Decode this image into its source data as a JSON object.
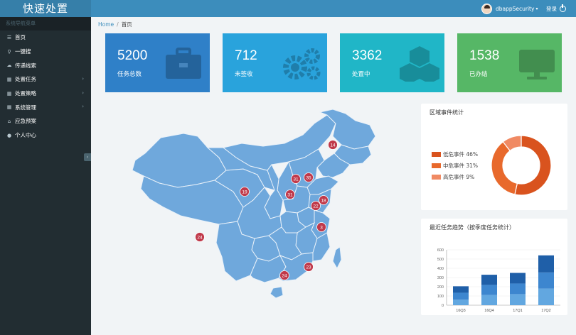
{
  "header": {
    "title": "快速处置",
    "username": "dbappSecurity",
    "login_label": "登录"
  },
  "sidebar": {
    "header": "系统导航菜单",
    "items": [
      {
        "label": "首页",
        "icon": "menu-icon"
      },
      {
        "label": "一键搜",
        "icon": "search-icon"
      },
      {
        "label": "传递线索",
        "icon": "cloud-icon"
      },
      {
        "label": "处置任务",
        "icon": "grid-icon",
        "has_children": true
      },
      {
        "label": "处置策略",
        "icon": "grid-icon",
        "has_children": true
      },
      {
        "label": "系统管理",
        "icon": "grid-icon",
        "has_children": true
      },
      {
        "label": "应急预案",
        "icon": "bank-icon"
      },
      {
        "label": "个人中心",
        "icon": "user-icon"
      }
    ]
  },
  "breadcrumb": {
    "home": "Home",
    "current": "首页"
  },
  "stats": [
    {
      "value": "5200",
      "label": "任务总数",
      "color": "#2f80c8",
      "icon": "briefcase-icon"
    },
    {
      "value": "712",
      "label": "未签收",
      "color": "#29a3dc",
      "icon": "gears-icon"
    },
    {
      "value": "3362",
      "label": "处置中",
      "color": "#20b6c7",
      "icon": "cubes-icon"
    },
    {
      "value": "1538",
      "label": "已办结",
      "color": "#56b766",
      "icon": "monitor-icon"
    }
  ],
  "map": {
    "markers": [
      {
        "label": "14"
      },
      {
        "label": "31"
      },
      {
        "label": "35"
      },
      {
        "label": "19"
      },
      {
        "label": "31"
      },
      {
        "label": "18"
      },
      {
        "label": "22"
      },
      {
        "label": "3"
      },
      {
        "label": "24"
      },
      {
        "label": "24"
      },
      {
        "label": "23"
      }
    ]
  },
  "region_panel": {
    "title": "区域事件统计",
    "legend": [
      {
        "label": "低危事件",
        "pct": "46%",
        "color": "#d9531e"
      },
      {
        "label": "中危事件",
        "pct": "31%",
        "color": "#e8692c"
      },
      {
        "label": "高危事件",
        "pct": "9%",
        "color": "#f08a63"
      }
    ],
    "chart_data": {
      "type": "pie",
      "categories": [
        "低危事件",
        "中危事件",
        "高危事件"
      ],
      "values": [
        46,
        31,
        9
      ]
    }
  },
  "trend_panel": {
    "title": "最近任务趋势（按季度任务统计）",
    "chart_data": {
      "type": "bar",
      "categories": [
        "16Q3",
        "16Q4",
        "17Q1",
        "17Q2"
      ],
      "series": [
        {
          "values": [
            60,
            110,
            120,
            180
          ],
          "color": "#62a7e0"
        },
        {
          "values": [
            75,
            110,
            115,
            175
          ],
          "color": "#3d86cf"
        },
        {
          "values": [
            70,
            110,
            115,
            185
          ],
          "color": "#1f5fa8"
        }
      ],
      "yticks": [
        "0",
        "100",
        "200",
        "300",
        "400",
        "500",
        "600"
      ],
      "ylim": [
        0,
        600
      ],
      "stacked": true
    }
  }
}
